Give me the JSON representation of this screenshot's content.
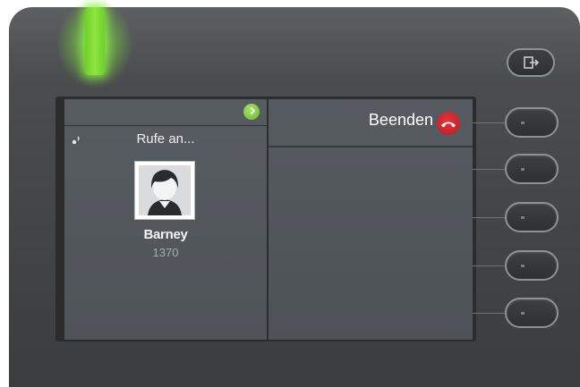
{
  "call": {
    "status_text": "Rufe an...",
    "contact_name": "Barney",
    "contact_number": "1370"
  },
  "actions": {
    "end_label": "Beenden"
  },
  "icons": {
    "status_dot": "check-icon",
    "ringing": "ringing-icon",
    "end_call": "hangup-icon",
    "exit": "exit-icon",
    "avatar": "person-icon"
  },
  "colors": {
    "led": "#8de642",
    "end_call": "#d42a30",
    "status_ok": "#8ccc4a"
  }
}
